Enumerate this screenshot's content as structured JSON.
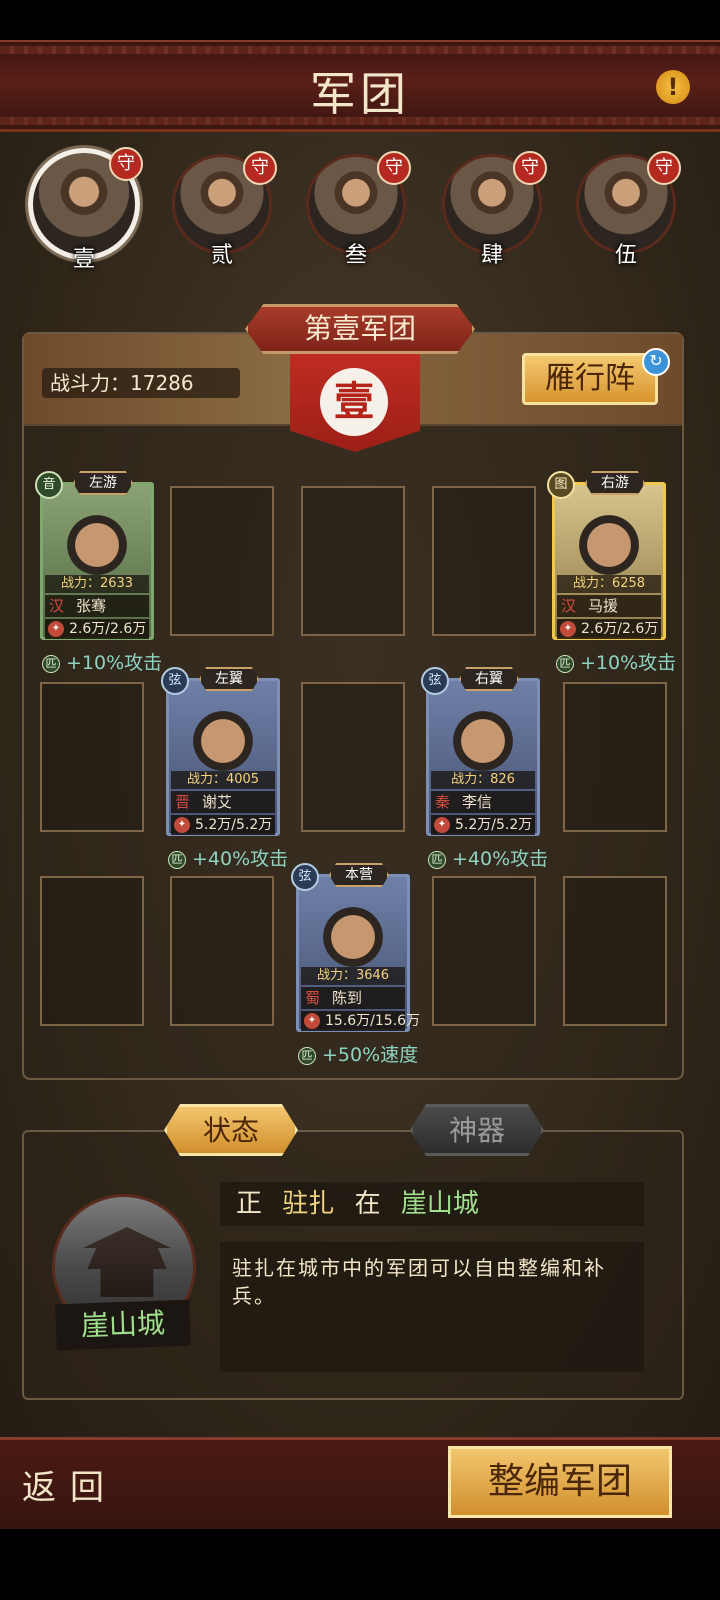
{
  "header": {
    "title": "军团"
  },
  "legions": [
    {
      "numeral": "壹",
      "status": "守",
      "selected": true
    },
    {
      "numeral": "贰",
      "status": "守",
      "selected": false
    },
    {
      "numeral": "叁",
      "status": "守",
      "selected": false
    },
    {
      "numeral": "肆",
      "status": "守",
      "selected": false
    },
    {
      "numeral": "伍",
      "status": "守",
      "selected": false
    }
  ],
  "legion": {
    "name": "第壹军团",
    "banner": "壹",
    "power_label": "战斗力：17286",
    "formation": "雁行阵"
  },
  "generals": [
    {
      "position": "左游",
      "kind": "音",
      "power": "战力：2633",
      "state": "汉",
      "name": "张骞",
      "troops": "2.6万/2.6万",
      "buff": "+10%攻击",
      "buff_icon": "匹",
      "color": "green"
    },
    {
      "position": "右游",
      "kind": "图",
      "power": "战力：6258",
      "state": "汉",
      "name": "马援",
      "troops": "2.6万/2.6万",
      "buff": "+10%攻击",
      "buff_icon": "匹",
      "color": "gold"
    },
    {
      "position": "左翼",
      "kind": "弦",
      "power": "战力：4005",
      "state": "晋",
      "name": "谢艾",
      "troops": "5.2万/5.2万",
      "buff": "+40%攻击",
      "buff_icon": "匹",
      "color": "blue"
    },
    {
      "position": "右翼",
      "kind": "弦",
      "power": "战力：826",
      "state": "秦",
      "name": "李信",
      "troops": "5.2万/5.2万",
      "buff": "+40%攻击",
      "buff_icon": "匹",
      "color": "blue"
    },
    {
      "position": "本营",
      "kind": "弦",
      "power": "战力：3646",
      "state": "蜀",
      "name": "陈到",
      "troops": "15.6万/15.6万",
      "buff": "+50%速度",
      "buff_icon": "匹",
      "color": "blue"
    }
  ],
  "tabs": {
    "status": "状态",
    "artifact": "神器"
  },
  "status": {
    "prefix": "正",
    "action": "驻扎",
    "preposition": "在",
    "city": "崖山城",
    "description": "驻扎在城市中的军团可以自由整编和补兵。"
  },
  "city": {
    "name": "崖山城"
  },
  "footer": {
    "back": "返回",
    "reorganize": "整编军团"
  },
  "colors": {
    "accent_gold": "#d18f2d",
    "banner_red": "#c22d22",
    "highlight_green": "#9fe08e"
  },
  "icons": {
    "info": "exclamation-icon",
    "swap": "refresh-icon"
  }
}
